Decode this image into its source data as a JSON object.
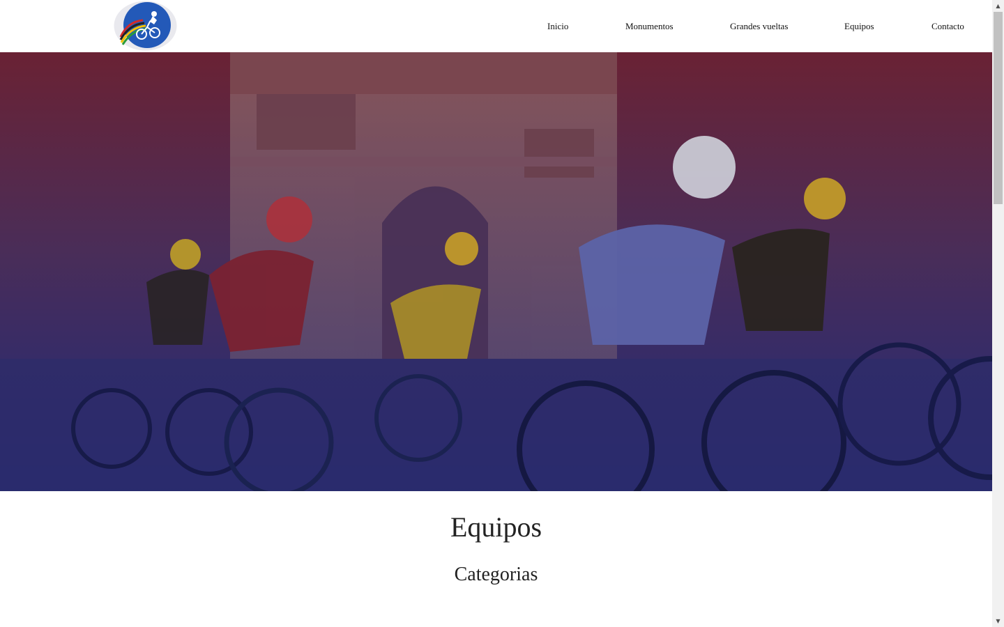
{
  "nav": {
    "items": [
      {
        "label": "Inicio"
      },
      {
        "label": "Monumentos"
      },
      {
        "label": "Grandes vueltas"
      },
      {
        "label": "Equipos"
      },
      {
        "label": "Contacto"
      }
    ]
  },
  "logo": {
    "icon": "cyclist-logo-icon",
    "colors": {
      "disc": "#2359b8",
      "stripes": [
        "#1b5fc0",
        "#d22a2a",
        "#222222",
        "#f2c200",
        "#2a9b3a"
      ]
    }
  },
  "hero": {
    "overlay_top": "#6a2234",
    "overlay_bottom": "#1f2a7a"
  },
  "main": {
    "title": "Equipos",
    "subtitle": "Categorias"
  }
}
